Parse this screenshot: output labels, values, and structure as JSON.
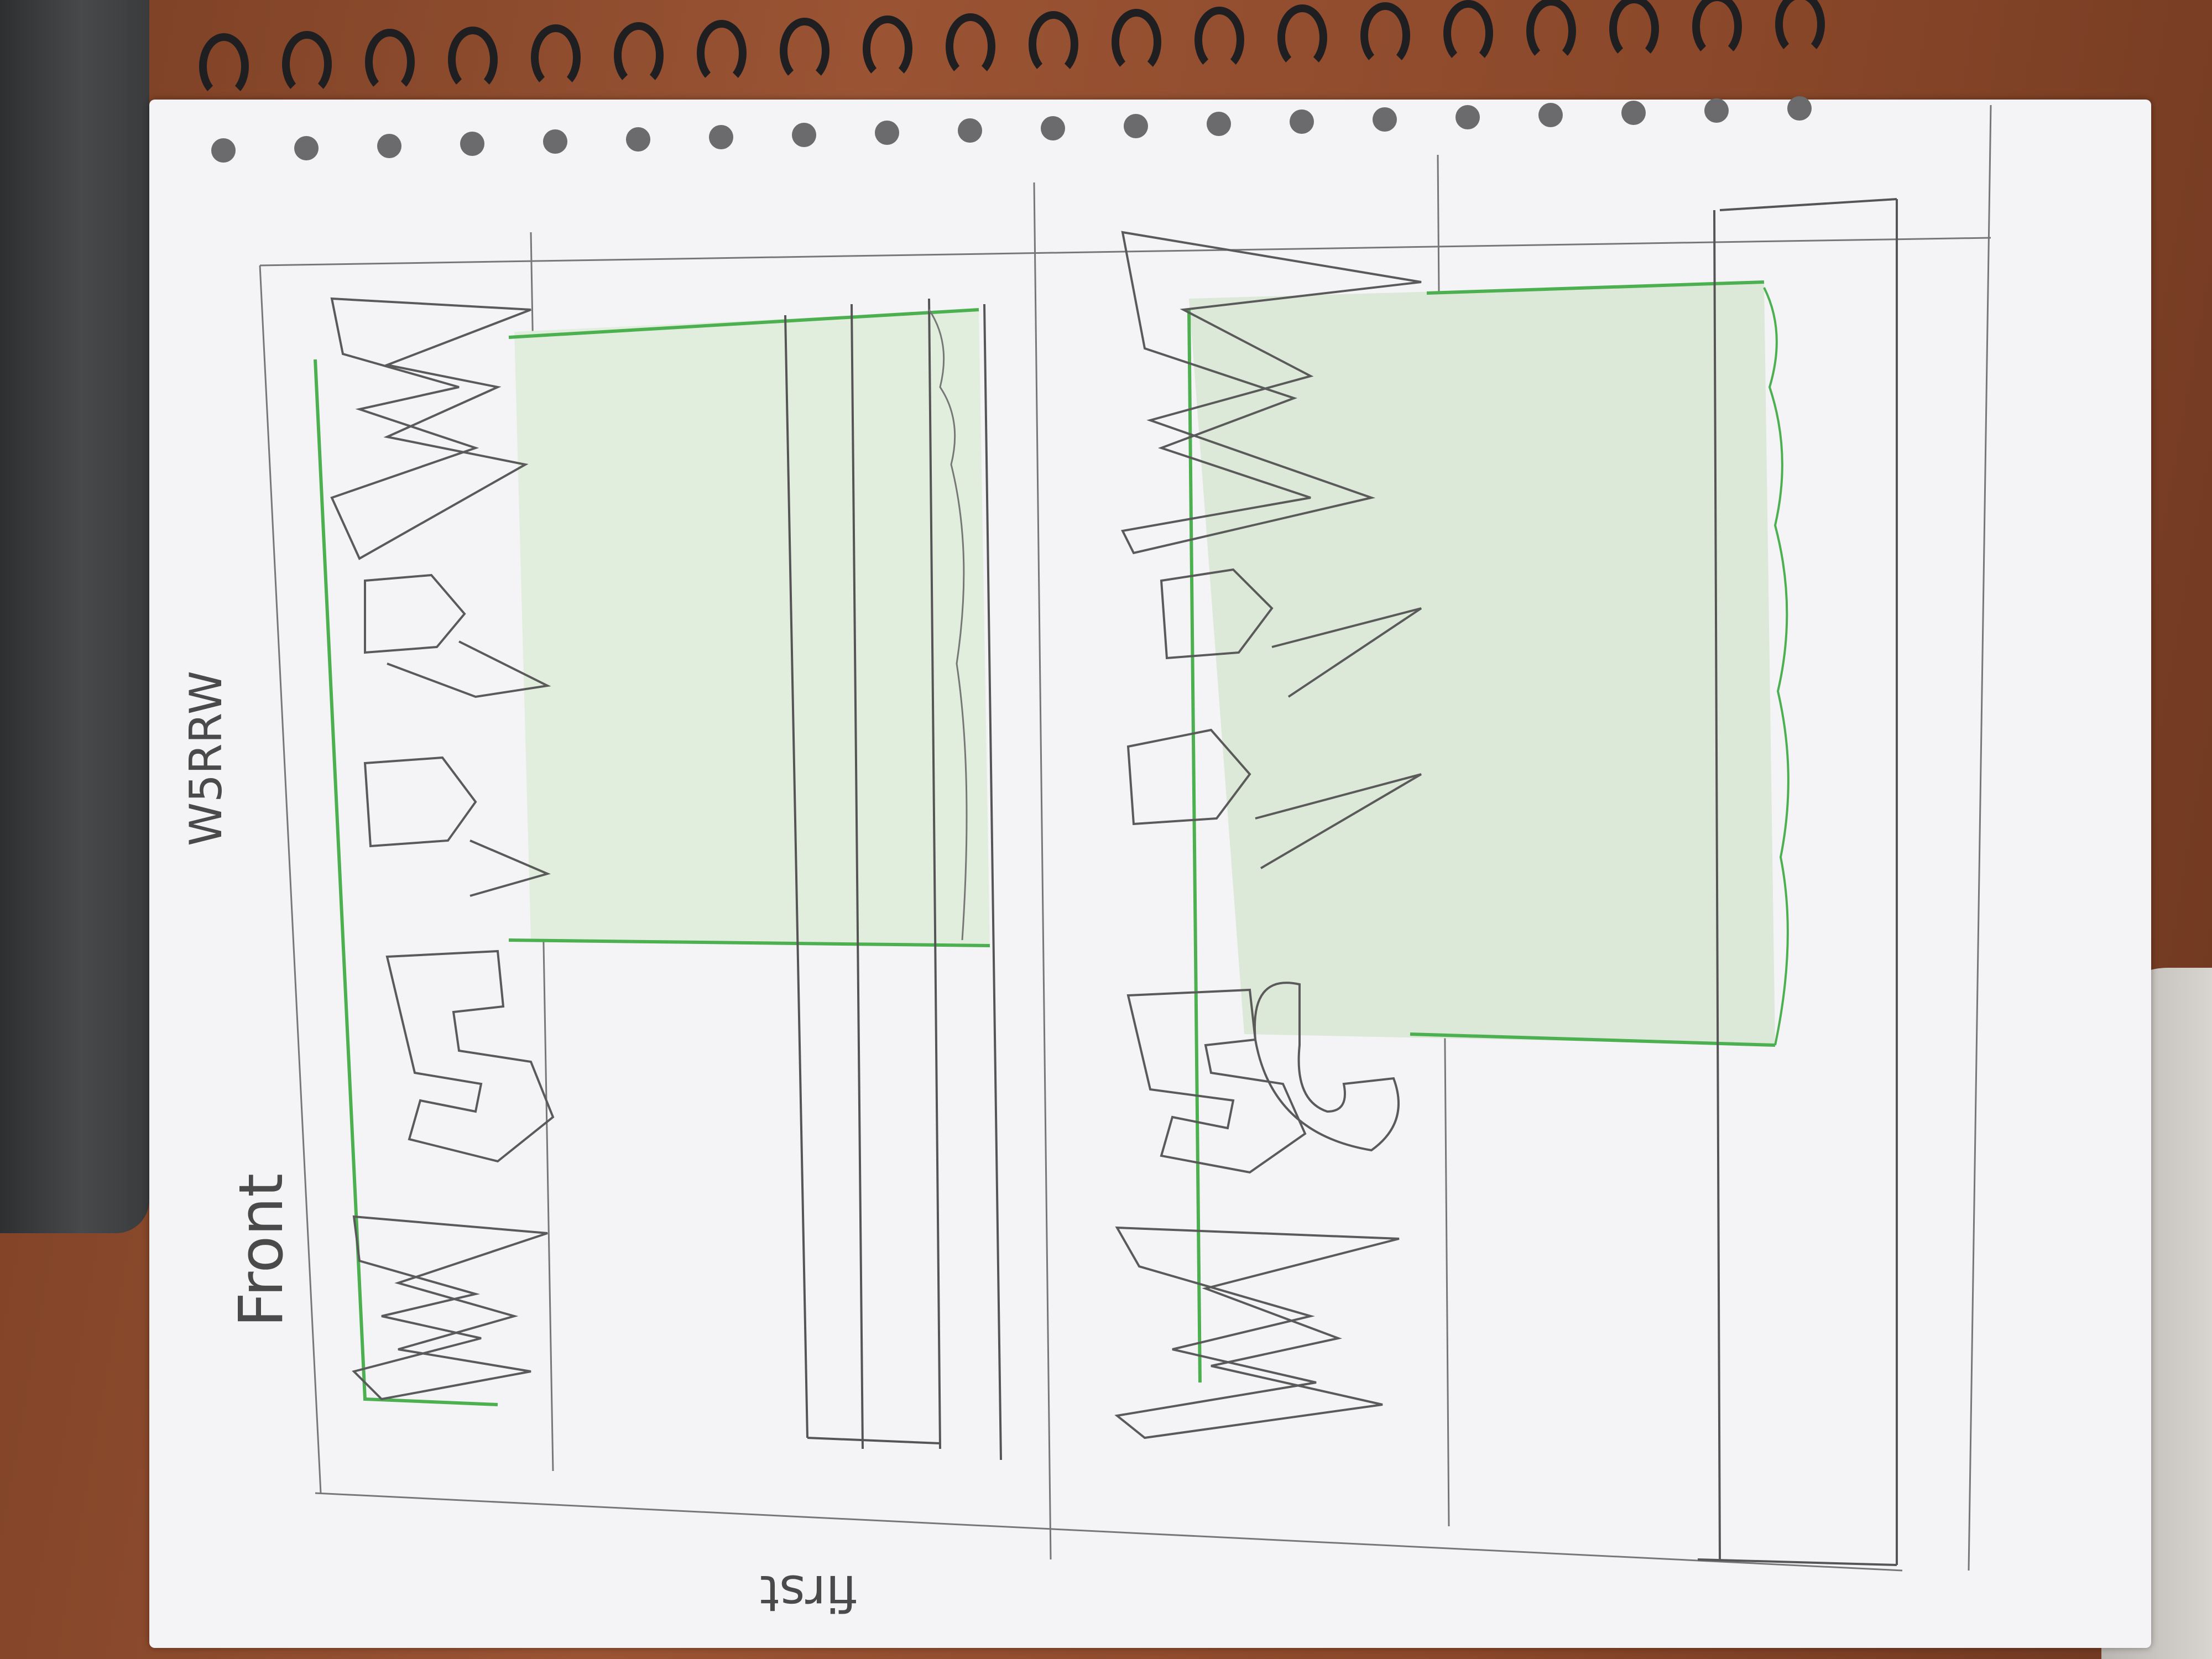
{
  "scene": {
    "subject": "pencil sketch on spiral notebook page",
    "colors": {
      "paper": "#f4f4f6",
      "pencil": "#555555",
      "green": "#4cb050",
      "green_fill": "#dcebd8",
      "desk": "#8a4a2e"
    }
  },
  "labels": {
    "front": "Front",
    "code": "W5RRW",
    "first": "first"
  },
  "sign_top": {
    "letters": [
      "W",
      "5",
      "R",
      "R",
      "W"
    ]
  },
  "sign_bottom": {
    "letters": [
      "W",
      "5",
      "G",
      "R",
      "R",
      "W"
    ]
  }
}
